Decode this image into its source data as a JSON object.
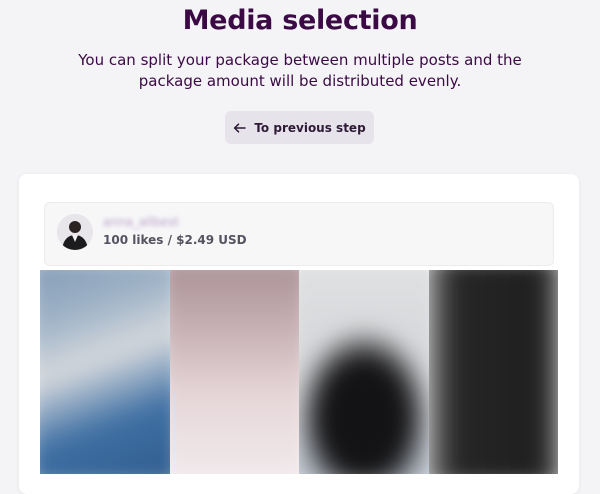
{
  "header": {
    "title": "Media selection",
    "subtitle": "You can split your package between multiple posts and the package amount will be distributed evenly."
  },
  "back_button": {
    "label": "To previous step",
    "icon": "arrow-left-icon"
  },
  "account": {
    "username": "anna_allbest",
    "package": "100 likes / $2.49 USD",
    "avatar_icon": "avatar"
  },
  "media": {
    "items": [
      {
        "name": "media-thumb-1",
        "colors": [
          "#9fb3c7",
          "#3e6fa3",
          "#d7dbe0"
        ]
      },
      {
        "name": "media-thumb-2",
        "colors": [
          "#c6b0b3",
          "#e6d6d8",
          "#f2ecee"
        ]
      },
      {
        "name": "media-thumb-3",
        "colors": [
          "#d9dadc",
          "#141416",
          "#b8c0cb"
        ]
      },
      {
        "name": "media-thumb-4",
        "colors": [
          "#2a2a2a",
          "#6b6b6b",
          "#dcdcdc"
        ]
      }
    ]
  },
  "colors": {
    "title": "#3b0a45",
    "background": "#f4f3f6",
    "button_bg": "#e6e4ea"
  }
}
